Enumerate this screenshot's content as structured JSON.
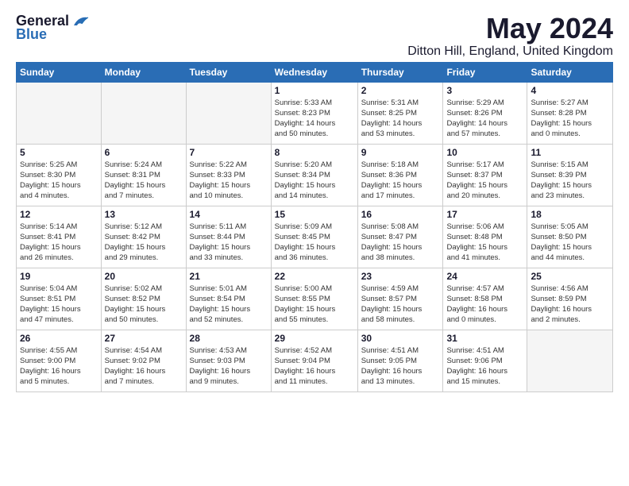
{
  "logo": {
    "general": "General",
    "blue": "Blue"
  },
  "title": "May 2024",
  "location": "Ditton Hill, England, United Kingdom",
  "days_of_week": [
    "Sunday",
    "Monday",
    "Tuesday",
    "Wednesday",
    "Thursday",
    "Friday",
    "Saturday"
  ],
  "weeks": [
    [
      {
        "day": "",
        "info": ""
      },
      {
        "day": "",
        "info": ""
      },
      {
        "day": "",
        "info": ""
      },
      {
        "day": "1",
        "info": "Sunrise: 5:33 AM\nSunset: 8:23 PM\nDaylight: 14 hours\nand 50 minutes."
      },
      {
        "day": "2",
        "info": "Sunrise: 5:31 AM\nSunset: 8:25 PM\nDaylight: 14 hours\nand 53 minutes."
      },
      {
        "day": "3",
        "info": "Sunrise: 5:29 AM\nSunset: 8:26 PM\nDaylight: 14 hours\nand 57 minutes."
      },
      {
        "day": "4",
        "info": "Sunrise: 5:27 AM\nSunset: 8:28 PM\nDaylight: 15 hours\nand 0 minutes."
      }
    ],
    [
      {
        "day": "5",
        "info": "Sunrise: 5:25 AM\nSunset: 8:30 PM\nDaylight: 15 hours\nand 4 minutes."
      },
      {
        "day": "6",
        "info": "Sunrise: 5:24 AM\nSunset: 8:31 PM\nDaylight: 15 hours\nand 7 minutes."
      },
      {
        "day": "7",
        "info": "Sunrise: 5:22 AM\nSunset: 8:33 PM\nDaylight: 15 hours\nand 10 minutes."
      },
      {
        "day": "8",
        "info": "Sunrise: 5:20 AM\nSunset: 8:34 PM\nDaylight: 15 hours\nand 14 minutes."
      },
      {
        "day": "9",
        "info": "Sunrise: 5:18 AM\nSunset: 8:36 PM\nDaylight: 15 hours\nand 17 minutes."
      },
      {
        "day": "10",
        "info": "Sunrise: 5:17 AM\nSunset: 8:37 PM\nDaylight: 15 hours\nand 20 minutes."
      },
      {
        "day": "11",
        "info": "Sunrise: 5:15 AM\nSunset: 8:39 PM\nDaylight: 15 hours\nand 23 minutes."
      }
    ],
    [
      {
        "day": "12",
        "info": "Sunrise: 5:14 AM\nSunset: 8:41 PM\nDaylight: 15 hours\nand 26 minutes."
      },
      {
        "day": "13",
        "info": "Sunrise: 5:12 AM\nSunset: 8:42 PM\nDaylight: 15 hours\nand 29 minutes."
      },
      {
        "day": "14",
        "info": "Sunrise: 5:11 AM\nSunset: 8:44 PM\nDaylight: 15 hours\nand 33 minutes."
      },
      {
        "day": "15",
        "info": "Sunrise: 5:09 AM\nSunset: 8:45 PM\nDaylight: 15 hours\nand 36 minutes."
      },
      {
        "day": "16",
        "info": "Sunrise: 5:08 AM\nSunset: 8:47 PM\nDaylight: 15 hours\nand 38 minutes."
      },
      {
        "day": "17",
        "info": "Sunrise: 5:06 AM\nSunset: 8:48 PM\nDaylight: 15 hours\nand 41 minutes."
      },
      {
        "day": "18",
        "info": "Sunrise: 5:05 AM\nSunset: 8:50 PM\nDaylight: 15 hours\nand 44 minutes."
      }
    ],
    [
      {
        "day": "19",
        "info": "Sunrise: 5:04 AM\nSunset: 8:51 PM\nDaylight: 15 hours\nand 47 minutes."
      },
      {
        "day": "20",
        "info": "Sunrise: 5:02 AM\nSunset: 8:52 PM\nDaylight: 15 hours\nand 50 minutes."
      },
      {
        "day": "21",
        "info": "Sunrise: 5:01 AM\nSunset: 8:54 PM\nDaylight: 15 hours\nand 52 minutes."
      },
      {
        "day": "22",
        "info": "Sunrise: 5:00 AM\nSunset: 8:55 PM\nDaylight: 15 hours\nand 55 minutes."
      },
      {
        "day": "23",
        "info": "Sunrise: 4:59 AM\nSunset: 8:57 PM\nDaylight: 15 hours\nand 58 minutes."
      },
      {
        "day": "24",
        "info": "Sunrise: 4:57 AM\nSunset: 8:58 PM\nDaylight: 16 hours\nand 0 minutes."
      },
      {
        "day": "25",
        "info": "Sunrise: 4:56 AM\nSunset: 8:59 PM\nDaylight: 16 hours\nand 2 minutes."
      }
    ],
    [
      {
        "day": "26",
        "info": "Sunrise: 4:55 AM\nSunset: 9:00 PM\nDaylight: 16 hours\nand 5 minutes."
      },
      {
        "day": "27",
        "info": "Sunrise: 4:54 AM\nSunset: 9:02 PM\nDaylight: 16 hours\nand 7 minutes."
      },
      {
        "day": "28",
        "info": "Sunrise: 4:53 AM\nSunset: 9:03 PM\nDaylight: 16 hours\nand 9 minutes."
      },
      {
        "day": "29",
        "info": "Sunrise: 4:52 AM\nSunset: 9:04 PM\nDaylight: 16 hours\nand 11 minutes."
      },
      {
        "day": "30",
        "info": "Sunrise: 4:51 AM\nSunset: 9:05 PM\nDaylight: 16 hours\nand 13 minutes."
      },
      {
        "day": "31",
        "info": "Sunrise: 4:51 AM\nSunset: 9:06 PM\nDaylight: 16 hours\nand 15 minutes."
      },
      {
        "day": "",
        "info": ""
      }
    ]
  ]
}
